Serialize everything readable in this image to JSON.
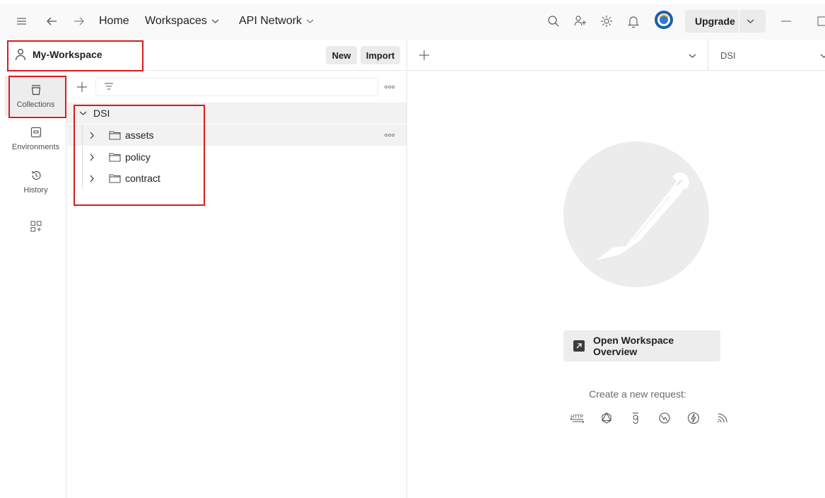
{
  "topbar": {
    "nav_home": "Home",
    "nav_workspaces": "Workspaces",
    "nav_api_network": "API Network",
    "upgrade_label": "Upgrade",
    "icons": [
      "menu-icon",
      "back-arrow-icon",
      "forward-arrow-icon",
      "search-icon",
      "invite-user-icon",
      "settings-icon",
      "notifications-icon",
      "avatar",
      "minimize-icon",
      "maximize-icon"
    ]
  },
  "workspace": {
    "name": "My-Workspace",
    "new_label": "New",
    "import_label": "Import"
  },
  "sidebar": {
    "items": [
      {
        "label": "Collections",
        "icon": "collections-icon",
        "active": true
      },
      {
        "label": "Environments",
        "icon": "environments-icon",
        "active": false
      },
      {
        "label": "History",
        "icon": "history-icon",
        "active": false
      },
      {
        "label": "",
        "icon": "configure-sidebar-icon",
        "active": false
      }
    ]
  },
  "tree": {
    "collection": "DSI",
    "folders": [
      "assets",
      "policy",
      "contract"
    ]
  },
  "tabs": {
    "environment": "DSI"
  },
  "main": {
    "overview_label": "Open Workspace Overview",
    "create_label": "Create a new request:",
    "request_types": [
      "http-icon",
      "graphql-icon",
      "grpc-icon",
      "websocket-icon",
      "socketio-icon",
      "mqtt-icon"
    ]
  },
  "colors": {
    "annotation_red": "#d91b1b",
    "topbar_bg": "#f9f9f9",
    "button_bg": "#ebebeb"
  }
}
